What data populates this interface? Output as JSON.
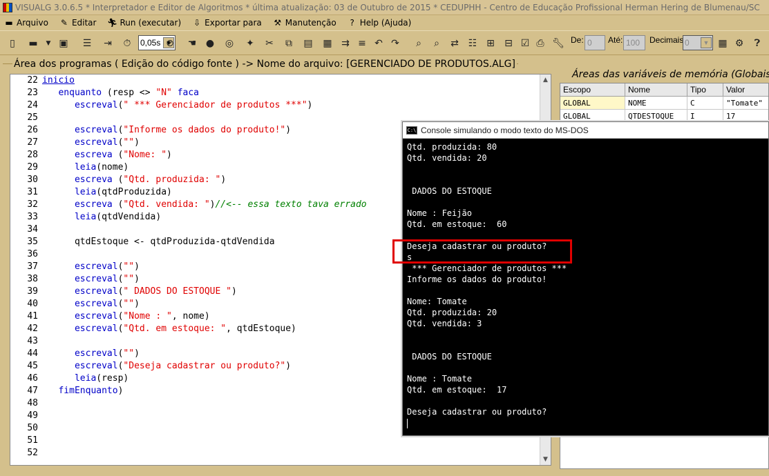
{
  "window": {
    "title": "VISUALG 3.0.6.5 * Interpretador e Editor de Algoritmos * última atualização: 03 de Outubro de 2015 * CEDUPHH - Centro de Educação Profissional Herman Hering de Blumenau/SC"
  },
  "menu": [
    {
      "label": "Arquivo",
      "icon": "folder-icon"
    },
    {
      "label": "Editar",
      "icon": "edit-icon"
    },
    {
      "label": "Run (executar)",
      "icon": "run-icon"
    },
    {
      "label": "Exportar para",
      "icon": "export-icon"
    },
    {
      "label": "Manutenção",
      "icon": "tools-icon"
    },
    {
      "label": "Help (Ajuda)",
      "icon": "help-icon"
    }
  ],
  "toolbar": {
    "speed_value": "0,05s",
    "de_label": "De:",
    "de_value": "0",
    "ate_label": "Até:",
    "ate_value": "100",
    "decimais_label": "Decimais:",
    "decimais_value": "0"
  },
  "editor": {
    "header": "Área dos programas ( Edição do código fonte ) -> Nome do arquivo: [GERENCIADO DE PRODUTOS.ALG]",
    "lines": [
      {
        "n": "22",
        "parts": [
          [
            "kw-u",
            "inicio"
          ]
        ]
      },
      {
        "n": "23",
        "parts": [
          [
            "",
            "   "
          ],
          [
            "kw",
            "enquanto"
          ],
          [
            "",
            " (resp <> "
          ],
          [
            "str",
            "\"N\""
          ],
          [
            "",
            " "
          ],
          [
            "kw",
            "faca"
          ]
        ]
      },
      {
        "n": "24",
        "parts": [
          [
            "",
            "      "
          ],
          [
            "kw",
            "escreval"
          ],
          [
            "",
            "("
          ],
          [
            "str",
            "\" *** Gerenciador de produtos ***\""
          ],
          [
            "",
            ")"
          ]
        ]
      },
      {
        "n": "25",
        "parts": []
      },
      {
        "n": "26",
        "parts": [
          [
            "",
            "      "
          ],
          [
            "kw",
            "escreval"
          ],
          [
            "",
            "("
          ],
          [
            "str",
            "\"Informe os dados do produto!\""
          ],
          [
            "",
            ")"
          ]
        ]
      },
      {
        "n": "27",
        "parts": [
          [
            "",
            "      "
          ],
          [
            "kw",
            "escreval"
          ],
          [
            "",
            "("
          ],
          [
            "str",
            "\"\""
          ],
          [
            "",
            ")"
          ]
        ]
      },
      {
        "n": "28",
        "parts": [
          [
            "",
            "      "
          ],
          [
            "kw",
            "escreva"
          ],
          [
            "",
            " ("
          ],
          [
            "str",
            "\"Nome: \""
          ],
          [
            "",
            ")"
          ]
        ]
      },
      {
        "n": "29",
        "parts": [
          [
            "",
            "      "
          ],
          [
            "kw",
            "leia"
          ],
          [
            "",
            "(nome)"
          ]
        ]
      },
      {
        "n": "30",
        "parts": [
          [
            "",
            "      "
          ],
          [
            "kw",
            "escreva"
          ],
          [
            "",
            " ("
          ],
          [
            "str",
            "\"Qtd. produzida: \""
          ],
          [
            "",
            ")"
          ]
        ]
      },
      {
        "n": "31",
        "parts": [
          [
            "",
            "      "
          ],
          [
            "kw",
            "leia"
          ],
          [
            "",
            "(qtdProduzida)"
          ]
        ]
      },
      {
        "n": "32",
        "parts": [
          [
            "",
            "      "
          ],
          [
            "kw",
            "escreva"
          ],
          [
            "",
            " ("
          ],
          [
            "str",
            "\"Qtd. vendida: \""
          ],
          [
            "",
            ")"
          ],
          [
            "cm",
            "//<-- essa texto tava errado"
          ]
        ]
      },
      {
        "n": "33",
        "parts": [
          [
            "",
            "      "
          ],
          [
            "kw",
            "leia"
          ],
          [
            "",
            "(qtdVendida)"
          ]
        ]
      },
      {
        "n": "34",
        "parts": []
      },
      {
        "n": "35",
        "parts": [
          [
            "",
            "      qtdEstoque <- qtdProduzida-qtdVendida"
          ]
        ]
      },
      {
        "n": "36",
        "parts": []
      },
      {
        "n": "37",
        "parts": [
          [
            "",
            "      "
          ],
          [
            "kw",
            "escreval"
          ],
          [
            "",
            "("
          ],
          [
            "str",
            "\"\""
          ],
          [
            "",
            ")"
          ]
        ]
      },
      {
        "n": "38",
        "parts": [
          [
            "",
            "      "
          ],
          [
            "kw",
            "escreval"
          ],
          [
            "",
            "("
          ],
          [
            "str",
            "\"\""
          ],
          [
            "",
            ")"
          ]
        ]
      },
      {
        "n": "39",
        "parts": [
          [
            "",
            "      "
          ],
          [
            "kw",
            "escreval"
          ],
          [
            "",
            "("
          ],
          [
            "str",
            "\" DADOS DO ESTOQUE \""
          ],
          [
            "",
            ")"
          ]
        ]
      },
      {
        "n": "40",
        "parts": [
          [
            "",
            "      "
          ],
          [
            "kw",
            "escreval"
          ],
          [
            "",
            "("
          ],
          [
            "str",
            "\"\""
          ],
          [
            "",
            ")"
          ]
        ]
      },
      {
        "n": "41",
        "parts": [
          [
            "",
            "      "
          ],
          [
            "kw",
            "escreval"
          ],
          [
            "",
            "("
          ],
          [
            "str",
            "\"Nome : \""
          ],
          [
            "",
            ", nome)"
          ]
        ]
      },
      {
        "n": "42",
        "parts": [
          [
            "",
            "      "
          ],
          [
            "kw",
            "escreval"
          ],
          [
            "",
            "("
          ],
          [
            "str",
            "\"Qtd. em estoque: \""
          ],
          [
            "",
            ", qtdEstoque)"
          ]
        ]
      },
      {
        "n": "43",
        "parts": []
      },
      {
        "n": "44",
        "parts": [
          [
            "",
            "      "
          ],
          [
            "kw",
            "escreval"
          ],
          [
            "",
            "("
          ],
          [
            "str",
            "\"\""
          ],
          [
            "",
            ")"
          ]
        ]
      },
      {
        "n": "45",
        "parts": [
          [
            "",
            "      "
          ],
          [
            "kw",
            "escreval"
          ],
          [
            "",
            "("
          ],
          [
            "str",
            "\"Deseja cadastrar ou produto?\""
          ],
          [
            "",
            ")"
          ]
        ]
      },
      {
        "n": "46",
        "parts": [
          [
            "",
            "      "
          ],
          [
            "kw",
            "leia"
          ],
          [
            "",
            "(resp)"
          ]
        ]
      },
      {
        "n": "47",
        "parts": [
          [
            "",
            "   "
          ],
          [
            "kw",
            "fimEnquanto"
          ],
          [
            "",
            ")"
          ]
        ]
      },
      {
        "n": "48",
        "parts": []
      },
      {
        "n": "49",
        "parts": []
      },
      {
        "n": "50",
        "parts": []
      },
      {
        "n": "51",
        "parts": []
      },
      {
        "n": "52",
        "parts": []
      }
    ]
  },
  "variables": {
    "title": "Áreas das variáveis de memória (Globais",
    "columns": [
      "Escopo",
      "Nome",
      "Tipo",
      "Valor"
    ],
    "rows": [
      [
        "GLOBAL",
        "NOME",
        "C",
        "\"Tomate\""
      ],
      [
        "GLOBAL",
        "QTDESTOQUE",
        "I",
        "17"
      ]
    ]
  },
  "console": {
    "title": "Console simulando o modo texto do MS-DOS",
    "lines": [
      "Qtd. produzida: 80",
      "Qtd. vendida: 20",
      "",
      "",
      " DADOS DO ESTOQUE",
      "",
      "Nome : Feijão",
      "Qtd. em estoque:  60",
      "",
      "Deseja cadastrar ou produto?",
      "s",
      " *** Gerenciador de produtos ***",
      "Informe os dados do produto!",
      "",
      "Nome: Tomate",
      "Qtd. produzida: 20",
      "Qtd. vendida: 3",
      "",
      "",
      " DADOS DO ESTOQUE",
      "",
      "Nome : Tomate",
      "Qtd. em estoque:  17",
      "",
      "Deseja cadastrar ou produto?"
    ]
  }
}
